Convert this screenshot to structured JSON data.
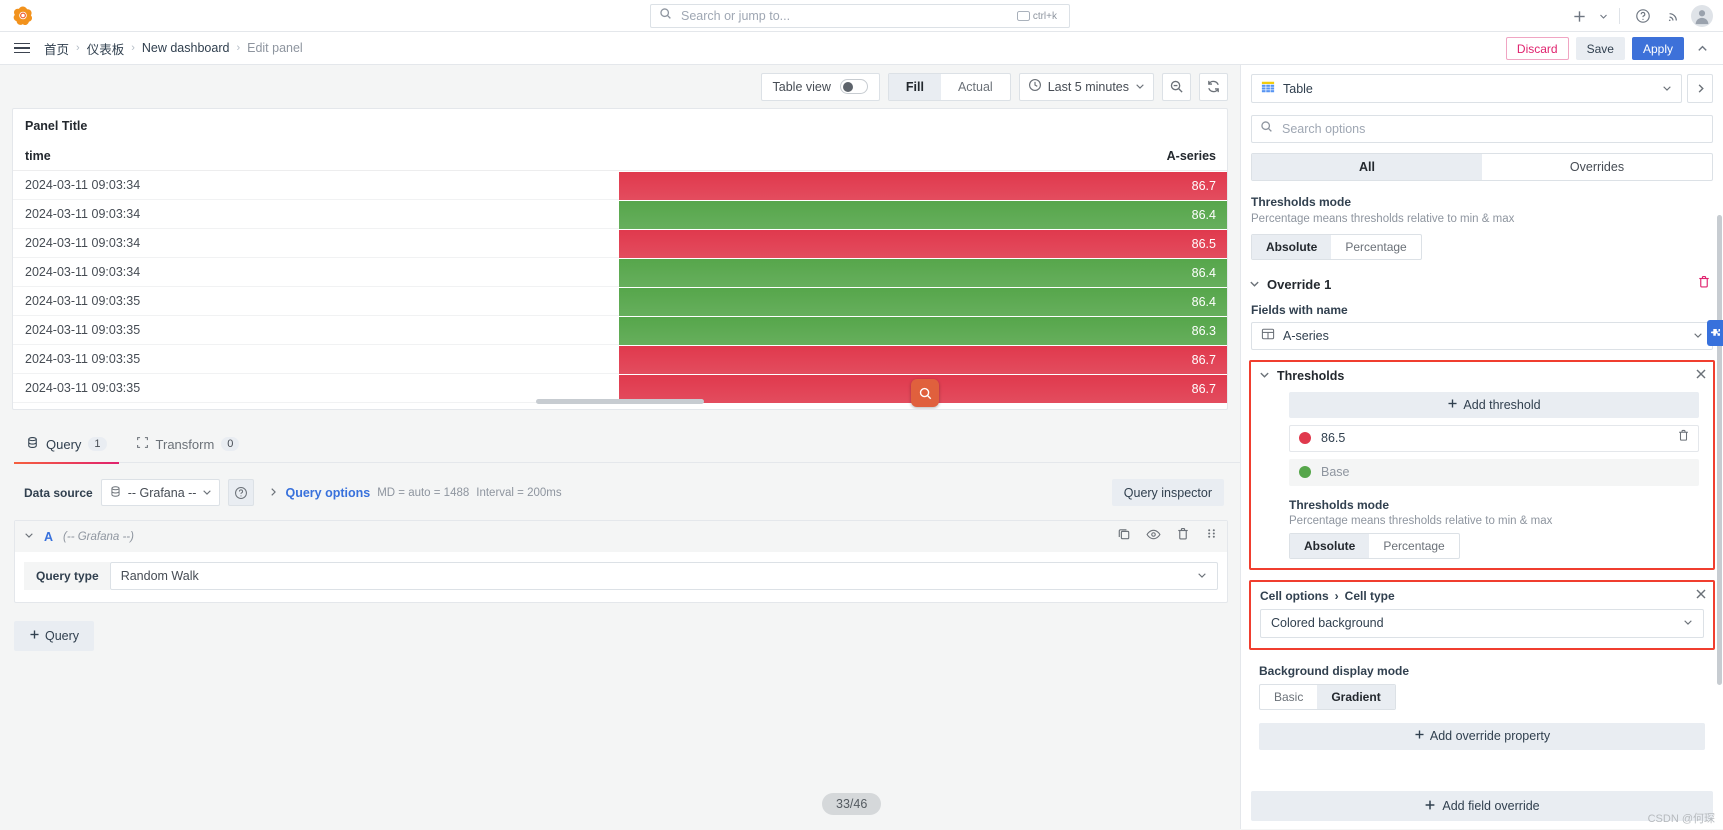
{
  "topbar": {
    "logo_icon": "grafana-logo-icon",
    "search": {
      "placeholder": "Search or jump to...",
      "value": "",
      "shortcut": "ctrl+k",
      "icon": "search-icon"
    },
    "plus_icon": "plus-icon",
    "help_icon": "help-circle-icon",
    "news_icon": "rss-news-icon",
    "avatar_icon": "user-avatar-icon"
  },
  "breadcrumb": {
    "menu_icon": "hamburger-menu-icon",
    "items": [
      {
        "label": "首页"
      },
      {
        "label": "仪表板"
      },
      {
        "label": "New dashboard"
      },
      {
        "label": "Edit panel"
      }
    ],
    "separator": "›",
    "discard_label": "Discard",
    "save_label": "Save",
    "apply_label": "Apply",
    "collapse_icon": "chevron-up-icon"
  },
  "panel_toolbar": {
    "table_view_label": "Table view",
    "table_view_on": false,
    "fit_options": [
      "Fill",
      "Actual"
    ],
    "fit_selected": "Fill",
    "time_range": "Last 5 minutes",
    "time_icon": "clock-icon",
    "chevron_icon": "chevron-down-icon",
    "zoom_out_icon": "zoom-out-icon",
    "refresh_icon": "refresh-icon"
  },
  "panel": {
    "title": "Panel Title",
    "columns": [
      "time",
      "A-series"
    ],
    "rows": [
      {
        "time": "2024-03-11 09:03:34",
        "value": "86.7",
        "color": "#e0394d"
      },
      {
        "time": "2024-03-11 09:03:34",
        "value": "86.4",
        "color": "#56a64b"
      },
      {
        "time": "2024-03-11 09:03:34",
        "value": "86.5",
        "color": "#e0394d"
      },
      {
        "time": "2024-03-11 09:03:34",
        "value": "86.4",
        "color": "#56a64b"
      },
      {
        "time": "2024-03-11 09:03:35",
        "value": "86.4",
        "color": "#56a64b"
      },
      {
        "time": "2024-03-11 09:03:35",
        "value": "86.3",
        "color": "#56a64b"
      },
      {
        "time": "2024-03-11 09:03:35",
        "value": "86.7",
        "color": "#e0394d"
      },
      {
        "time": "2024-03-11 09:03:35",
        "value": "86.7",
        "color": "#e0394d"
      }
    ],
    "cursor_icon": "magnifier-cursor-icon"
  },
  "query_tabs": [
    {
      "label": "Query",
      "count": "1",
      "icon": "database-icon",
      "active": true
    },
    {
      "label": "Transform",
      "count": "0",
      "icon": "transform-icon",
      "active": false
    }
  ],
  "datasource_row": {
    "label": "Data source",
    "value": "-- Grafana --",
    "ds_icon": "grafana-datasource-icon",
    "help_icon": "help-circle-icon",
    "expand_icon": "chevron-right-icon",
    "query_options_label": "Query options",
    "md_text": "MD = auto = 1488",
    "interval_text": "Interval = 200ms",
    "query_inspector_label": "Query inspector"
  },
  "query_editor": {
    "ref_id": "A",
    "datasource_note": "(-- Grafana --)",
    "collapse_icon": "chevron-down-icon",
    "duplicate_icon": "copy-icon",
    "hide_icon": "eye-icon",
    "delete_icon": "trash-icon",
    "drag_icon": "drag-handle-icon",
    "query_type_label": "Query type",
    "query_type_value": "Random Walk",
    "add_query_label": "Query",
    "add_query_icon": "plus-icon"
  },
  "options_pane": {
    "viz_name": "Table",
    "viz_icon": "table-viz-icon",
    "viz_chevron_icon": "chevron-down-icon",
    "viz_expand_icon": "chevron-right-icon",
    "search": {
      "placeholder": "Search options",
      "value": "",
      "icon": "search-icon"
    },
    "tabs": [
      "All",
      "Overrides"
    ],
    "tab_selected": "All",
    "thresholds_mode_label": "Thresholds mode",
    "thresholds_mode_desc": "Percentage means thresholds relative to min & max",
    "thresholds_mode_options": [
      "Absolute",
      "Percentage"
    ],
    "thresholds_mode_selected": "Absolute",
    "override": {
      "title": "Override 1",
      "collapse_icon": "chevron-down-icon",
      "delete_icon": "trash-icon",
      "fields_label": "Fields with name",
      "fields_value": "A-series",
      "fields_icon": "field-name-icon",
      "fields_chevron_icon": "chevron-down-icon"
    },
    "thresholds": {
      "section_title": "Thresholds",
      "collapse_icon": "chevron-down-icon",
      "close_icon": "close-icon",
      "add_label": "Add threshold",
      "add_icon": "plus-icon",
      "items": [
        {
          "value": "86.5",
          "color": "#e0394d",
          "deletable": true,
          "delete_icon": "trash-icon"
        },
        {
          "value": "Base",
          "color": "#56a64b",
          "deletable": false
        }
      ],
      "mode_label": "Thresholds mode",
      "mode_desc": "Percentage means thresholds relative to min & max",
      "mode_options": [
        "Absolute",
        "Percentage"
      ],
      "mode_selected": "Absolute"
    },
    "cell_options": {
      "breadcrumb_parent": "Cell options",
      "breadcrumb_sep": "›",
      "breadcrumb_child": "Cell type",
      "close_icon": "close-icon",
      "value": "Colored background",
      "chevron_icon": "chevron-down-icon",
      "bg_mode_label": "Background display mode",
      "bg_mode_options": [
        "Basic",
        "Gradient"
      ],
      "bg_mode_selected": "Gradient"
    },
    "add_override_property_label": "Add override property",
    "add_override_property_icon": "plus-icon",
    "add_field_override_label": "Add field override",
    "add_field_override_icon": "plus-icon",
    "side_handle_icon": "puzzle-icon"
  },
  "footer": {
    "page_indicator": "33/46",
    "watermark": "CSDN @何琛"
  },
  "colors": {
    "accent_blue": "#3d71d9",
    "red": "#e0394d",
    "green": "#56a64b",
    "highlight_box": "#f03e2f",
    "discard_pink": "#e0226e"
  }
}
